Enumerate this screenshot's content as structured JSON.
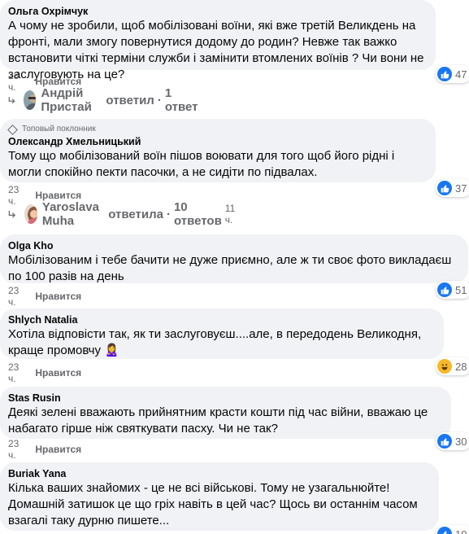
{
  "comments": [
    {
      "author": "Ольга Охрімчук",
      "text": "А чому не зробили, щоб мобілізовані воїни, які вже третій Великдень на фронті, мали змогу повернутися додому до родин? Невже так важко встановити чіткі терміни служби і замінити втомлених воїнів ? Чи вони не заслуговують на це?",
      "time": "23 ч.",
      "like_label": "Нравится",
      "reaction_count": "47",
      "reply_author": "Андрій Пристай",
      "reply_verb": "ответил",
      "reply_dot": "·",
      "reply_count_label": "1 ответ"
    },
    {
      "badge": "Топовый поклонник",
      "author": "Олександр Хмельницький",
      "text": "Тому що мобілізований воїн пішов воювати для того щоб його рідні і могли спокійно пекти пасочки, а не сидіти по підвалах.",
      "time": "23 ч.",
      "like_label": "Нравится",
      "reaction_count": "37",
      "reply_author": "Yaroslava Muha",
      "reply_verb": "ответила",
      "reply_dot": "·",
      "reply_count_label": "10 ответов",
      "reply_time": "11 ч."
    },
    {
      "author": "Olga Kho",
      "text": "Мобілізованим і тебе бачити не дуже приємно, але ж ти своє фото викладаєш по 100 разів на день",
      "time": "23 ч.",
      "like_label": "Нравится",
      "reaction_count": "51"
    },
    {
      "author": "Shlych Natalia",
      "text": "Хотіла відповісти так, як ти заслуговуєш....але, в передодень Великодня, краще промовчу",
      "emoji": "🙎‍♀️",
      "time": "23 ч.",
      "like_label": "Нравится",
      "reaction_count": "28"
    },
    {
      "author": "Stas Rusin",
      "text": "Деякі зелені вважають прийнятним красти кошти під час війни, вважаю це набагато гірше ніж святкувати пасху. Чи не так?",
      "time": "23 ч.",
      "like_label": "Нравится",
      "reaction_count": "30"
    },
    {
      "author": "Buriak Yana",
      "text": "Кілька ваших знайомих - це не всі військові. Тому не узагальнюйте! Домашній затишок це що гріх навіть в цей час? Щось ви останнім часом взагалі таку дурню пишете...",
      "reaction_count": "19"
    }
  ],
  "colors": {
    "bubble": "#f0f2f5",
    "meta": "#65676b",
    "like_blue": "#1877f2",
    "haha_yellow": "#f7b928"
  },
  "icons": [
    "like-reaction-icon",
    "haha-reaction-icon",
    "reply-arrow-icon",
    "top-fan-diamond-icon"
  ]
}
